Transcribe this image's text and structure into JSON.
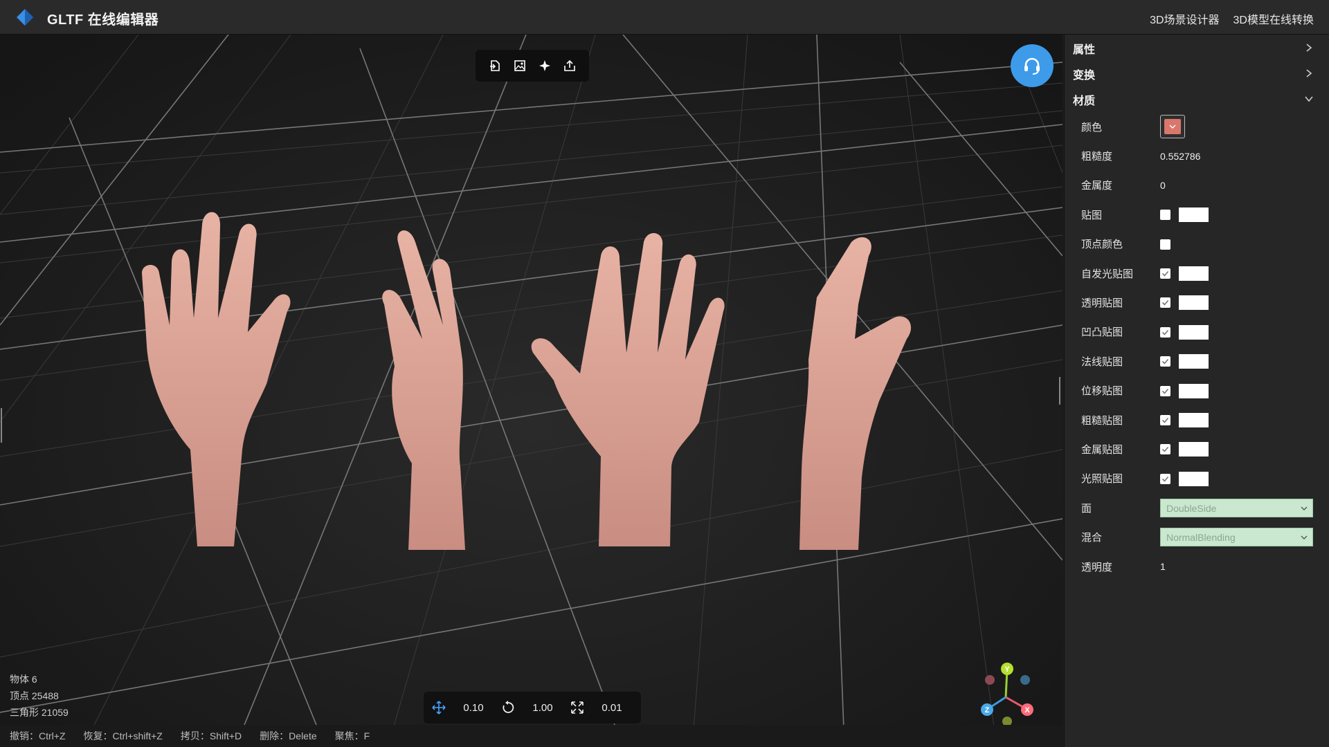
{
  "app": {
    "title": "GLTF 在线编辑器",
    "nav": [
      "3D场景设计器",
      "3D模型在线转换"
    ]
  },
  "viewport": {
    "toolbar": [
      "import-icon",
      "image-icon",
      "light-icon",
      "export-icon"
    ],
    "stats": {
      "objects": "物体 6",
      "vertices": "顶点 25488",
      "triangles": "三角形 21059"
    },
    "transform": {
      "translate": "0.10",
      "rotate": "1.00",
      "scale": "0.01"
    },
    "shortcuts": [
      "撤销：Ctrl+Z",
      "恢复：Ctrl+shift+Z",
      "拷贝：Shift+D",
      "删除：Delete",
      "聚焦：F"
    ],
    "gizmo": {
      "y": "Y",
      "x": "X",
      "z": "Z"
    }
  },
  "panel": {
    "sections": {
      "properties": "属性",
      "transform": "变换",
      "material": "材质"
    },
    "material": {
      "color_label": "颜色",
      "color_value": "#d9776c",
      "roughness_label": "粗糙度",
      "roughness_value": "0.552786",
      "metalness_label": "金属度",
      "metalness_value": "0",
      "map_label": "贴图",
      "vertex_colors_label": "顶点颜色",
      "emissive_map_label": "自发光贴图",
      "alpha_map_label": "透明贴图",
      "bump_map_label": "凹凸贴图",
      "normal_map_label": "法线贴图",
      "displacement_map_label": "位移贴图",
      "roughness_map_label": "粗糙贴图",
      "metalness_map_label": "金属贴图",
      "light_map_label": "光照贴图",
      "side_label": "面",
      "side_value": "DoubleSide",
      "blending_label": "混合",
      "blending_value": "NormalBlending",
      "opacity_label": "透明度",
      "opacity_value": "1"
    }
  }
}
